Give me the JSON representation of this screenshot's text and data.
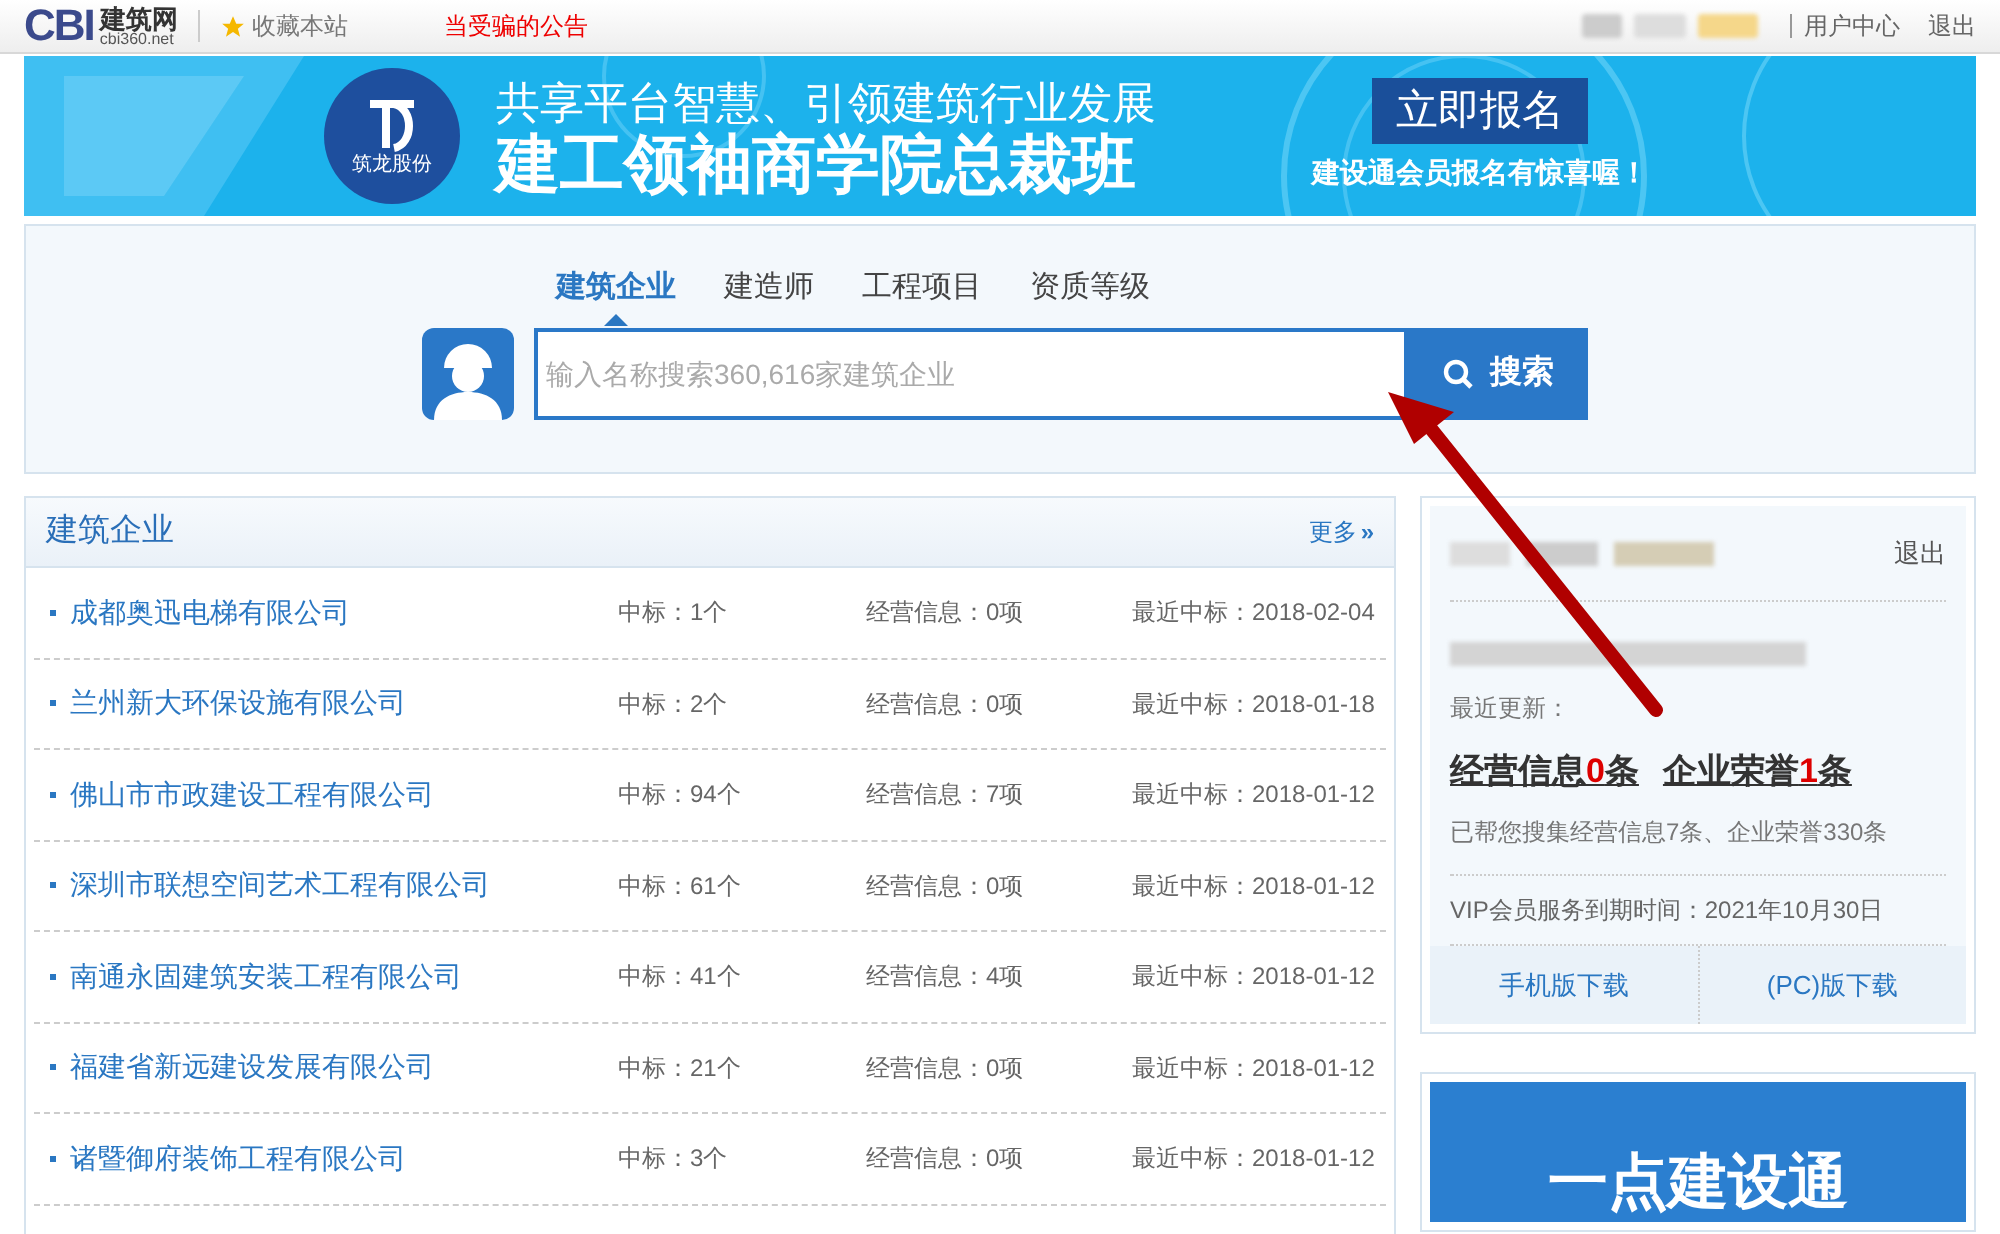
{
  "top_bar": {
    "logo": {
      "mark": "CBI",
      "name": "建筑网",
      "domain": "cbi360.net"
    },
    "bookmark": "收藏本站",
    "notice": "当受骗的公告",
    "links": [
      "用户中心",
      "退出"
    ]
  },
  "banner": {
    "logo_text": "筑龙股份",
    "headline": "共享平台智慧、引领建筑行业发展",
    "title": "建工领袖商学院总裁班",
    "cta": "立即报名",
    "promo": "建设通会员报名有惊喜喔！"
  },
  "search": {
    "tabs": [
      {
        "label": "建筑企业",
        "selected": true
      },
      {
        "label": "建造师",
        "selected": false
      },
      {
        "label": "工程项目",
        "selected": false
      },
      {
        "label": "资质等级",
        "selected": false
      }
    ],
    "placeholder": "输入名称搜索360,616家建筑企业",
    "button": "搜索"
  },
  "companies": {
    "title": "建筑企业",
    "more": "更多",
    "more_icon": "»",
    "rows": [
      {
        "name": "成都奥迅电梯有限公司",
        "bids": "中标：1个",
        "business": "经营信息：0项",
        "latest": "最近中标：2018-02-04"
      },
      {
        "name": "兰州新大环保设施有限公司",
        "bids": "中标：2个",
        "business": "经营信息：0项",
        "latest": "最近中标：2018-01-18"
      },
      {
        "name": "佛山市市政建设工程有限公司",
        "bids": "中标：94个",
        "business": "经营信息：7项",
        "latest": "最近中标：2018-01-12"
      },
      {
        "name": "深圳市联想空间艺术工程有限公司",
        "bids": "中标：61个",
        "business": "经营信息：0项",
        "latest": "最近中标：2018-01-12"
      },
      {
        "name": "南通永固建筑安装工程有限公司",
        "bids": "中标：41个",
        "business": "经营信息：4项",
        "latest": "最近中标：2018-01-12"
      },
      {
        "name": "福建省新远建设发展有限公司",
        "bids": "中标：21个",
        "business": "经营信息：0项",
        "latest": "最近中标：2018-01-12"
      },
      {
        "name": "诸暨御府装饰工程有限公司",
        "bids": "中标：3个",
        "business": "经营信息：0项",
        "latest": "最近中标：2018-01-12"
      }
    ]
  },
  "account": {
    "logout": "退出",
    "recent_label": "最近更新：",
    "stats": [
      {
        "label": "经营信息",
        "count": "0",
        "unit": "条"
      },
      {
        "label": "企业荣誉",
        "count": "1",
        "unit": "条"
      }
    ],
    "summary": "已帮您搜集经营信息7条、企业荣誉330条",
    "expiry": "VIP会员服务到期时间：2021年10月30日",
    "downloads": [
      "手机版下载",
      "(PC)版下载"
    ]
  },
  "ad": {
    "text": "一点建设通"
  }
}
